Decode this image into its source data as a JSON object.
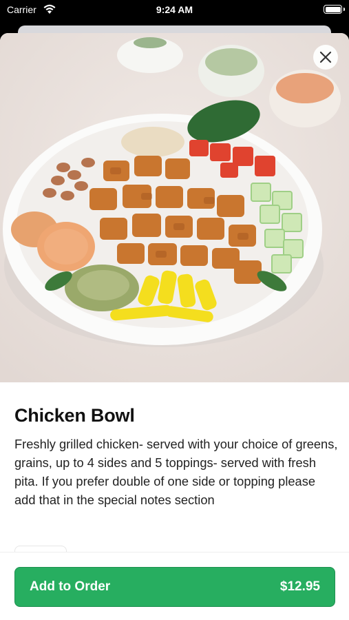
{
  "status_bar": {
    "carrier": "Carrier",
    "time": "9:24 AM"
  },
  "item": {
    "title": "Chicken Bowl",
    "description": "Freshly grilled chicken- served with your choice of greens, grains, up to 4 sides and 5 toppings- served with fresh pita. If you prefer double of one side or topping please add that in the special notes section"
  },
  "actions": {
    "close_icon": "close-icon",
    "add_to_order_label": "Add to Order",
    "price": "$12.95"
  },
  "colors": {
    "accent": "#27ae60",
    "hero_background": "#ebe3df"
  }
}
